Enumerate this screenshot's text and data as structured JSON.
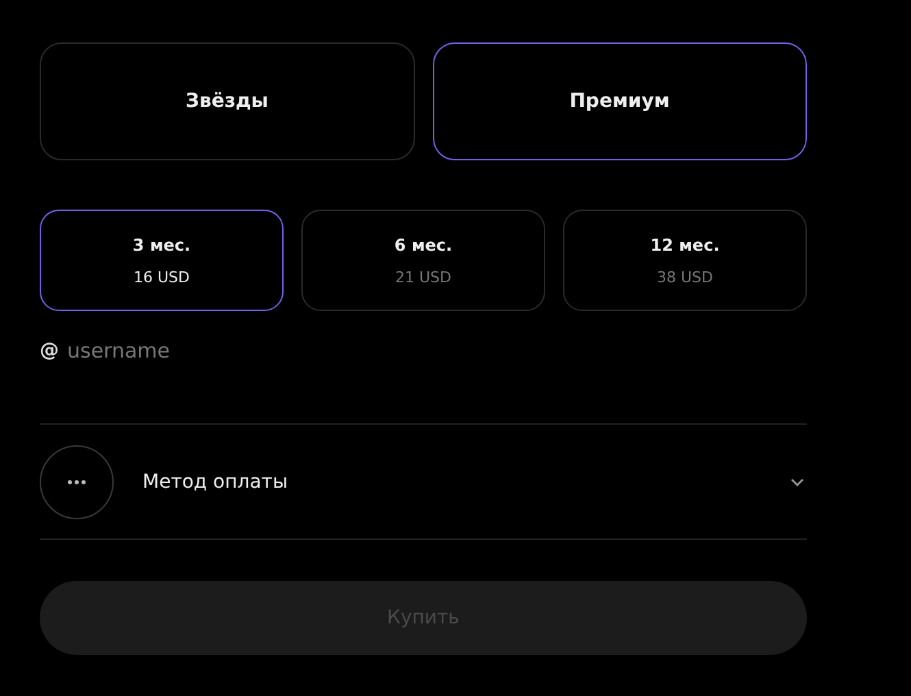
{
  "tabs": [
    {
      "label": "Звёзды",
      "selected": false
    },
    {
      "label": "Премиум",
      "selected": true
    }
  ],
  "plans": [
    {
      "duration": "3 мес.",
      "price": "16 USD",
      "selected": true
    },
    {
      "duration": "6 мес.",
      "price": "21 USD",
      "selected": false
    },
    {
      "duration": "12 мес.",
      "price": "38 USD",
      "selected": false
    }
  ],
  "recipient": {
    "prefix": "@",
    "placeholder": "username"
  },
  "payment_method": {
    "label": "Метод оплаты"
  },
  "buy_button": {
    "label": "Купить",
    "disabled": true
  }
}
